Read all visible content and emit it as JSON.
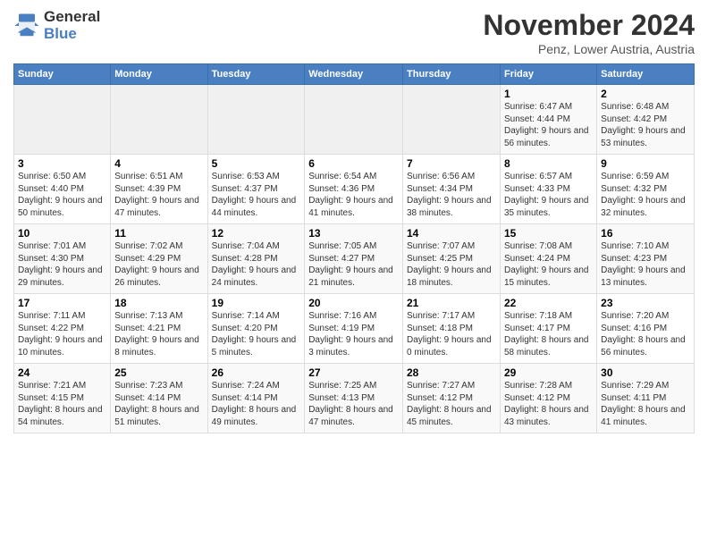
{
  "logo": {
    "general": "General",
    "blue": "Blue"
  },
  "title": "November 2024",
  "location": "Penz, Lower Austria, Austria",
  "days_header": [
    "Sunday",
    "Monday",
    "Tuesday",
    "Wednesday",
    "Thursday",
    "Friday",
    "Saturday"
  ],
  "weeks": [
    [
      {
        "day": "",
        "info": ""
      },
      {
        "day": "",
        "info": ""
      },
      {
        "day": "",
        "info": ""
      },
      {
        "day": "",
        "info": ""
      },
      {
        "day": "",
        "info": ""
      },
      {
        "day": "1",
        "info": "Sunrise: 6:47 AM\nSunset: 4:44 PM\nDaylight: 9 hours and 56 minutes."
      },
      {
        "day": "2",
        "info": "Sunrise: 6:48 AM\nSunset: 4:42 PM\nDaylight: 9 hours and 53 minutes."
      }
    ],
    [
      {
        "day": "3",
        "info": "Sunrise: 6:50 AM\nSunset: 4:40 PM\nDaylight: 9 hours and 50 minutes."
      },
      {
        "day": "4",
        "info": "Sunrise: 6:51 AM\nSunset: 4:39 PM\nDaylight: 9 hours and 47 minutes."
      },
      {
        "day": "5",
        "info": "Sunrise: 6:53 AM\nSunset: 4:37 PM\nDaylight: 9 hours and 44 minutes."
      },
      {
        "day": "6",
        "info": "Sunrise: 6:54 AM\nSunset: 4:36 PM\nDaylight: 9 hours and 41 minutes."
      },
      {
        "day": "7",
        "info": "Sunrise: 6:56 AM\nSunset: 4:34 PM\nDaylight: 9 hours and 38 minutes."
      },
      {
        "day": "8",
        "info": "Sunrise: 6:57 AM\nSunset: 4:33 PM\nDaylight: 9 hours and 35 minutes."
      },
      {
        "day": "9",
        "info": "Sunrise: 6:59 AM\nSunset: 4:32 PM\nDaylight: 9 hours and 32 minutes."
      }
    ],
    [
      {
        "day": "10",
        "info": "Sunrise: 7:01 AM\nSunset: 4:30 PM\nDaylight: 9 hours and 29 minutes."
      },
      {
        "day": "11",
        "info": "Sunrise: 7:02 AM\nSunset: 4:29 PM\nDaylight: 9 hours and 26 minutes."
      },
      {
        "day": "12",
        "info": "Sunrise: 7:04 AM\nSunset: 4:28 PM\nDaylight: 9 hours and 24 minutes."
      },
      {
        "day": "13",
        "info": "Sunrise: 7:05 AM\nSunset: 4:27 PM\nDaylight: 9 hours and 21 minutes."
      },
      {
        "day": "14",
        "info": "Sunrise: 7:07 AM\nSunset: 4:25 PM\nDaylight: 9 hours and 18 minutes."
      },
      {
        "day": "15",
        "info": "Sunrise: 7:08 AM\nSunset: 4:24 PM\nDaylight: 9 hours and 15 minutes."
      },
      {
        "day": "16",
        "info": "Sunrise: 7:10 AM\nSunset: 4:23 PM\nDaylight: 9 hours and 13 minutes."
      }
    ],
    [
      {
        "day": "17",
        "info": "Sunrise: 7:11 AM\nSunset: 4:22 PM\nDaylight: 9 hours and 10 minutes."
      },
      {
        "day": "18",
        "info": "Sunrise: 7:13 AM\nSunset: 4:21 PM\nDaylight: 9 hours and 8 minutes."
      },
      {
        "day": "19",
        "info": "Sunrise: 7:14 AM\nSunset: 4:20 PM\nDaylight: 9 hours and 5 minutes."
      },
      {
        "day": "20",
        "info": "Sunrise: 7:16 AM\nSunset: 4:19 PM\nDaylight: 9 hours and 3 minutes."
      },
      {
        "day": "21",
        "info": "Sunrise: 7:17 AM\nSunset: 4:18 PM\nDaylight: 9 hours and 0 minutes."
      },
      {
        "day": "22",
        "info": "Sunrise: 7:18 AM\nSunset: 4:17 PM\nDaylight: 8 hours and 58 minutes."
      },
      {
        "day": "23",
        "info": "Sunrise: 7:20 AM\nSunset: 4:16 PM\nDaylight: 8 hours and 56 minutes."
      }
    ],
    [
      {
        "day": "24",
        "info": "Sunrise: 7:21 AM\nSunset: 4:15 PM\nDaylight: 8 hours and 54 minutes."
      },
      {
        "day": "25",
        "info": "Sunrise: 7:23 AM\nSunset: 4:14 PM\nDaylight: 8 hours and 51 minutes."
      },
      {
        "day": "26",
        "info": "Sunrise: 7:24 AM\nSunset: 4:14 PM\nDaylight: 8 hours and 49 minutes."
      },
      {
        "day": "27",
        "info": "Sunrise: 7:25 AM\nSunset: 4:13 PM\nDaylight: 8 hours and 47 minutes."
      },
      {
        "day": "28",
        "info": "Sunrise: 7:27 AM\nSunset: 4:12 PM\nDaylight: 8 hours and 45 minutes."
      },
      {
        "day": "29",
        "info": "Sunrise: 7:28 AM\nSunset: 4:12 PM\nDaylight: 8 hours and 43 minutes."
      },
      {
        "day": "30",
        "info": "Sunrise: 7:29 AM\nSunset: 4:11 PM\nDaylight: 8 hours and 41 minutes."
      }
    ]
  ]
}
